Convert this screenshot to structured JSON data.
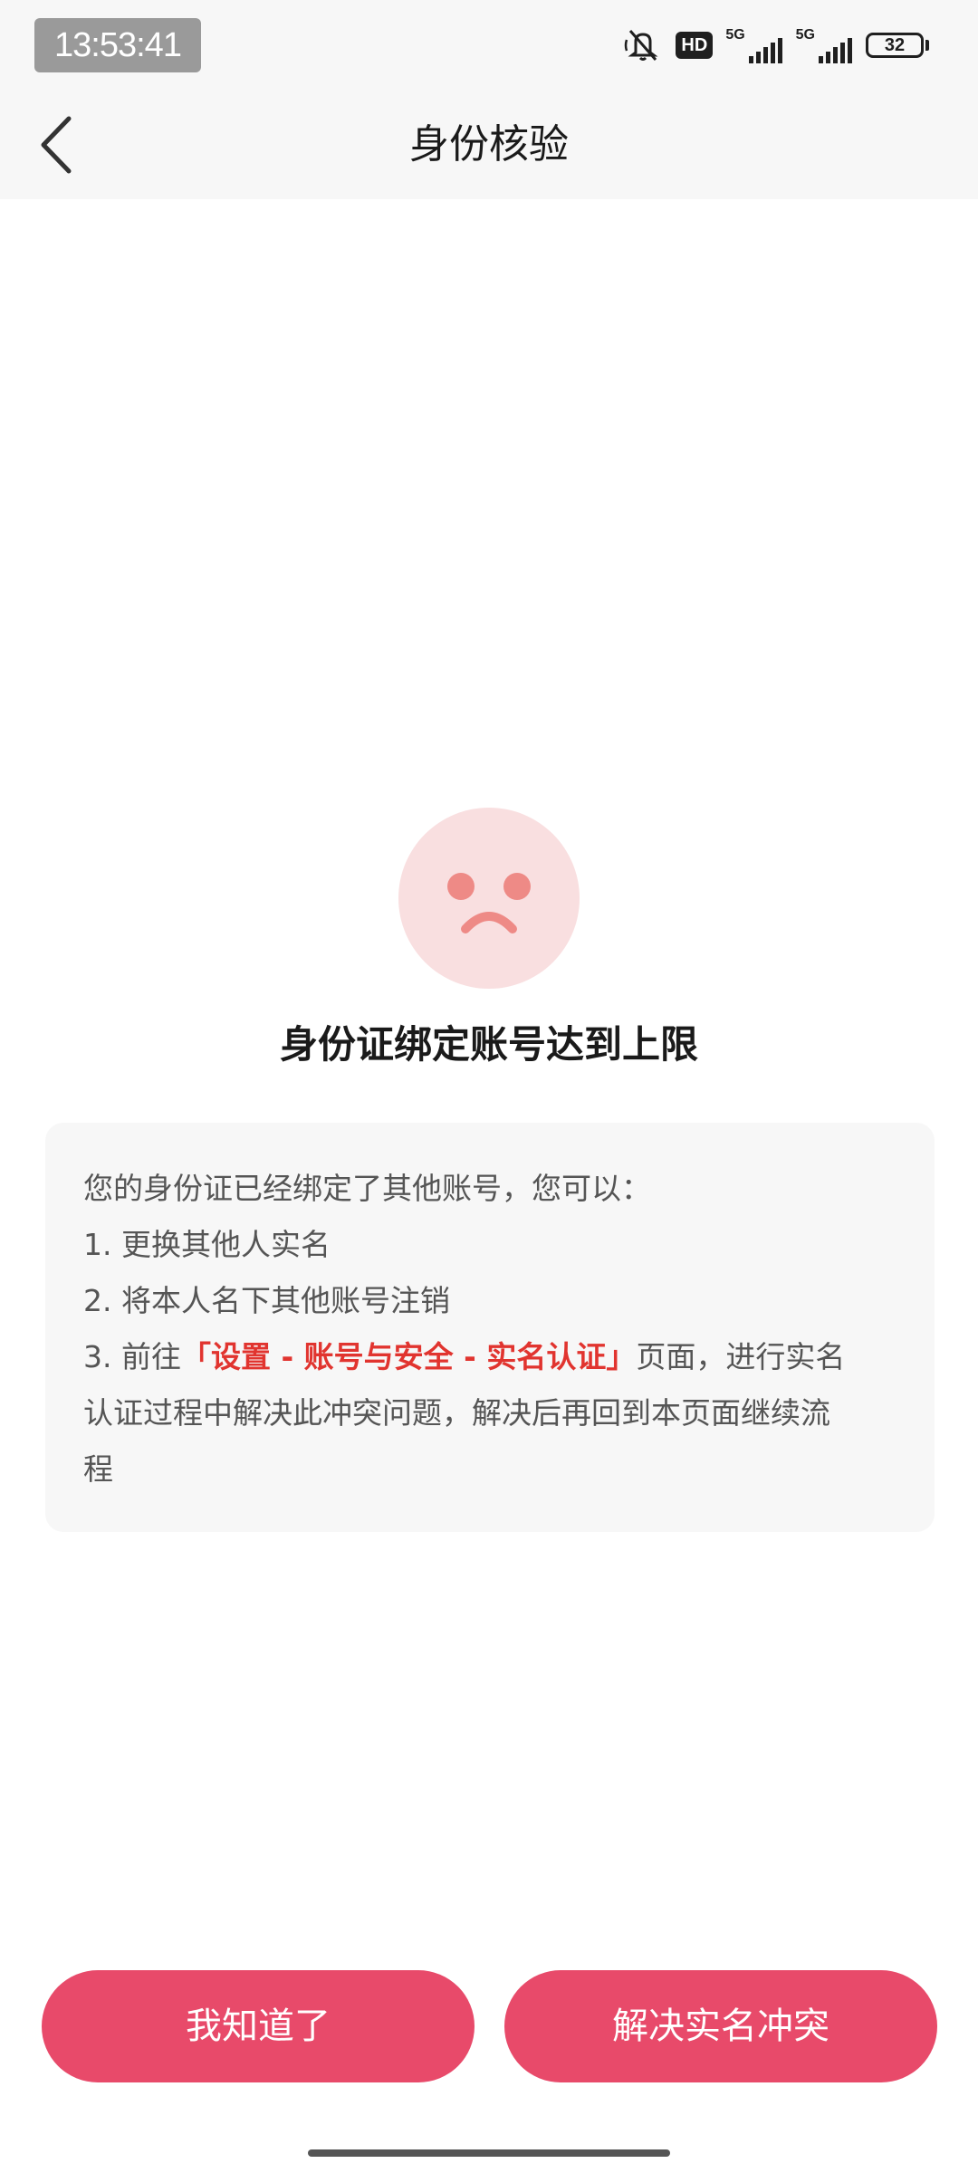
{
  "status_bar": {
    "time": "13:53:41",
    "hd_label": "HD",
    "network_1": "5G",
    "network_2": "5G",
    "battery": "32"
  },
  "header": {
    "title": "身份核验"
  },
  "result": {
    "title": "身份证绑定账号达到上限"
  },
  "info": {
    "intro": "您的身份证已经绑定了其他账号，您可以：",
    "option1": "1. 更换其他人实名",
    "option2": "2. 将本人名下其他账号注销",
    "option3_prefix": "3. 前往",
    "option3_highlight": "「设置 - 账号与安全 - 实名认证」",
    "option3_suffix_line1": "页面，进行实名",
    "option3_line2": "认证过程中解决此冲突问题，解决后再回到本页面继续流",
    "option3_line3": "程"
  },
  "buttons": {
    "ok": "我知道了",
    "resolve": "解决实名冲突"
  },
  "colors": {
    "accent": "#e84a6a",
    "highlight": "#e1342f",
    "face_bg": "#f9dfe0",
    "face_features": "#ee8a86"
  }
}
